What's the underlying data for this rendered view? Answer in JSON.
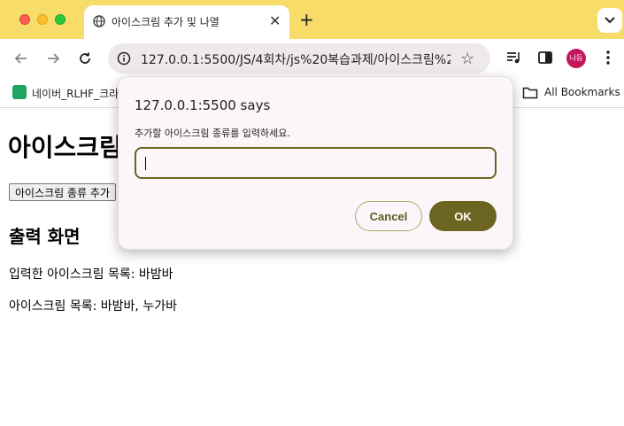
{
  "browser": {
    "tab": {
      "title": "아이스크림 추가 및 나열",
      "close_glyph": "✕",
      "icon": "globe-icon"
    },
    "new_tab_glyph": "+",
    "url": "127.0.0.1:5500/JS/4회차/js%20복습과제/아이스크림%2...",
    "avatar_text": "나듬",
    "bookmarks": {
      "item_label": "네이버_RLHF_크라",
      "all_label": "All Bookmarks"
    },
    "colors": {
      "tabstrip": "#f7dc6a",
      "omnibox": "#efe9ee",
      "avatar": "#c2185b"
    }
  },
  "page": {
    "title": "아이스크림",
    "add_button_label": "아이스크림 종류 추가",
    "output_heading": "출력 화면",
    "entered_line": "입력한 아이스크림 목록: 바밤바",
    "list_line": "아이스크림 목록: 바밤바, 누가바"
  },
  "dialog": {
    "origin": "127.0.0.1:5500 says",
    "message": "추가할 아이스크림 종류를 입력하세요.",
    "input_value": "",
    "cancel_label": "Cancel",
    "ok_label": "OK",
    "colors": {
      "accent": "#6c6522",
      "background": "#fcf6fb"
    }
  }
}
